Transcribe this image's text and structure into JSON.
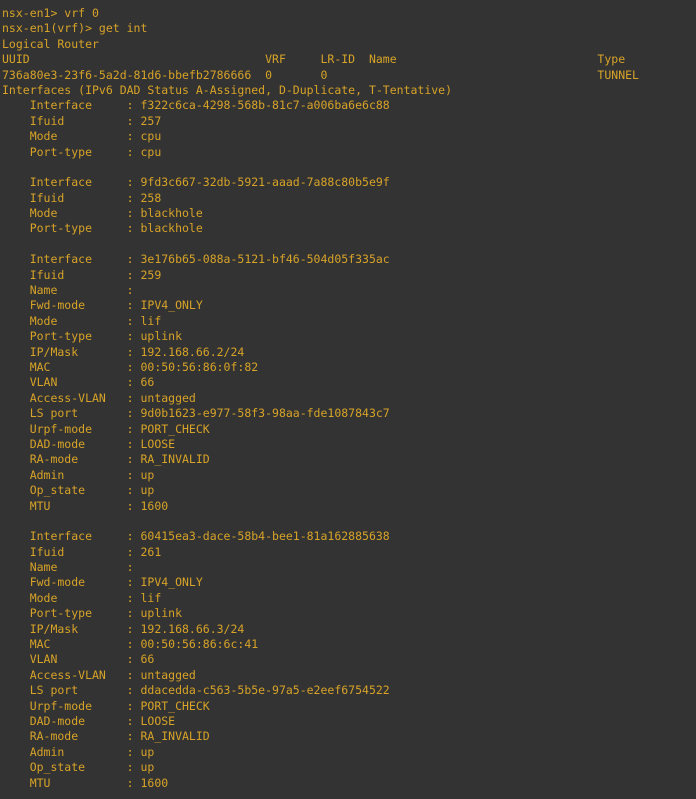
{
  "terminal": {
    "colors": {
      "background": "#333333",
      "foreground": "#d7a328"
    },
    "prompt_lines": [
      "nsx-en1> vrf 0",
      "nsx-en1(vrf)> get int"
    ],
    "section_title": "Logical Router",
    "router_table": {
      "headers": [
        "UUID",
        "VRF",
        "LR-ID",
        "Name",
        "Type"
      ],
      "header_line": "UUID                                  VRF    LR-ID  Name                                 Type",
      "rows": [
        {
          "uuid": "736a80e3-23f6-5a2d-81d6-bbefb2786666",
          "vrf": "0",
          "lr_id": "0",
          "name": "",
          "type": "TUNNEL",
          "row_line": "736a80e3-23f6-5a2d-81d6-bbefb2786666  0      0                                           TUNNEL"
        }
      ]
    },
    "interfaces_header": "Interfaces (IPv6 DAD Status A-Assigned, D-Duplicate, T-Tentative)",
    "interfaces": [
      {
        "fields": [
          {
            "label": "Interface",
            "value": "f322c6ca-4298-568b-81c7-a006ba6e6c88"
          },
          {
            "label": "Ifuid",
            "value": "257"
          },
          {
            "label": "Mode",
            "value": "cpu"
          },
          {
            "label": "Port-type",
            "value": "cpu"
          }
        ]
      },
      {
        "fields": [
          {
            "label": "Interface",
            "value": "9fd3c667-32db-5921-aaad-7a88c80b5e9f"
          },
          {
            "label": "Ifuid",
            "value": "258"
          },
          {
            "label": "Mode",
            "value": "blackhole"
          },
          {
            "label": "Port-type",
            "value": "blackhole"
          }
        ]
      },
      {
        "fields": [
          {
            "label": "Interface",
            "value": "3e176b65-088a-5121-bf46-504d05f335ac"
          },
          {
            "label": "Ifuid",
            "value": "259"
          },
          {
            "label": "Name",
            "value": ""
          },
          {
            "label": "Fwd-mode",
            "value": "IPV4_ONLY"
          },
          {
            "label": "Mode",
            "value": "lif"
          },
          {
            "label": "Port-type",
            "value": "uplink"
          },
          {
            "label": "IP/Mask",
            "value": "192.168.66.2/24"
          },
          {
            "label": "MAC",
            "value": "00:50:56:86:0f:82"
          },
          {
            "label": "VLAN",
            "value": "66"
          },
          {
            "label": "Access-VLAN",
            "value": "untagged"
          },
          {
            "label": "LS port",
            "value": "9d0b1623-e977-58f3-98aa-fde1087843c7"
          },
          {
            "label": "Urpf-mode",
            "value": "PORT_CHECK"
          },
          {
            "label": "DAD-mode",
            "value": "LOOSE"
          },
          {
            "label": "RA-mode",
            "value": "RA_INVALID"
          },
          {
            "label": "Admin",
            "value": "up"
          },
          {
            "label": "Op_state",
            "value": "up"
          },
          {
            "label": "MTU",
            "value": "1600"
          }
        ]
      },
      {
        "fields": [
          {
            "label": "Interface",
            "value": "60415ea3-dace-58b4-bee1-81a162885638"
          },
          {
            "label": "Ifuid",
            "value": "261"
          },
          {
            "label": "Name",
            "value": ""
          },
          {
            "label": "Fwd-mode",
            "value": "IPV4_ONLY"
          },
          {
            "label": "Mode",
            "value": "lif"
          },
          {
            "label": "Port-type",
            "value": "uplink"
          },
          {
            "label": "IP/Mask",
            "value": "192.168.66.3/24"
          },
          {
            "label": "MAC",
            "value": "00:50:56:86:6c:41"
          },
          {
            "label": "VLAN",
            "value": "66"
          },
          {
            "label": "Access-VLAN",
            "value": "untagged"
          },
          {
            "label": "LS port",
            "value": "ddacedda-c563-5b5e-97a5-e2eef6754522"
          },
          {
            "label": "Urpf-mode",
            "value": "PORT_CHECK"
          },
          {
            "label": "DAD-mode",
            "value": "LOOSE"
          },
          {
            "label": "RA-mode",
            "value": "RA_INVALID"
          },
          {
            "label": "Admin",
            "value": "up"
          },
          {
            "label": "Op_state",
            "value": "up"
          },
          {
            "label": "MTU",
            "value": "1600"
          }
        ]
      }
    ]
  }
}
